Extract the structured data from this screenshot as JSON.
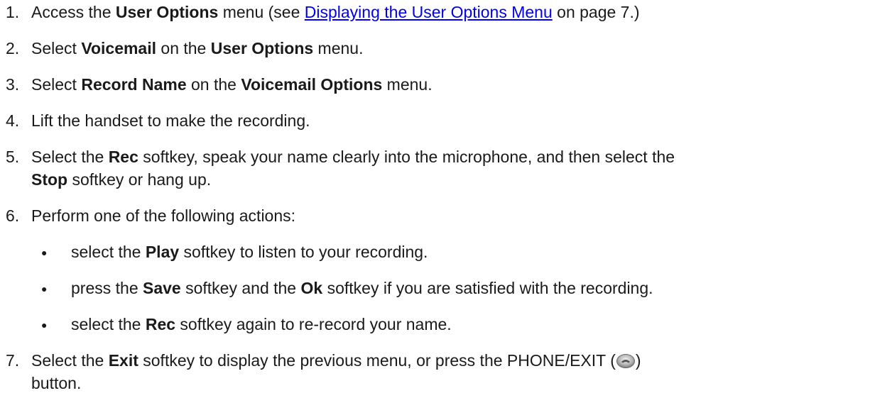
{
  "steps": [
    {
      "num": "1.",
      "t1": "Access the ",
      "b1": "User Options",
      "t2": " menu (see ",
      "link": "Displaying the User Options Menu",
      "t3": " on page 7.)"
    },
    {
      "num": "2.",
      "t1": "Select ",
      "b1": "Voicemail",
      "t2": " on the ",
      "b2": "User Options",
      "t3": " menu."
    },
    {
      "num": "3.",
      "t1": "Select ",
      "b1": "Record Name",
      "t2": " on the ",
      "b2": "Voicemail Options",
      "t3": " menu."
    },
    {
      "num": "4.",
      "t1": "Lift the handset to make the recording."
    },
    {
      "num": "5.",
      "t1": "Select the ",
      "b1": "Rec",
      "t2": " softkey, speak your name clearly into the microphone, and then select the",
      "b2": "Stop",
      "t3": " softkey or hang up."
    },
    {
      "num": "6.",
      "t1": "Perform one of the following actions:",
      "subs": [
        {
          "bullet": "●",
          "t1": "select the ",
          "b1": "Play",
          "t2": " softkey to listen to your recording."
        },
        {
          "bullet": "●",
          "t1": "press the ",
          "b1": "Save",
          "t2": " softkey and the ",
          "b2": "Ok",
          "t3": " softkey if you are satisfied with the recording."
        },
        {
          "bullet": "●",
          "t1": "select the ",
          "b1": "Rec",
          "t2": " softkey again to re-record your name."
        }
      ]
    },
    {
      "num": "7.",
      "t1": "Select the ",
      "b1": "Exit",
      "t2": " softkey to display the previous menu, or press the PHONE/EXIT (",
      "icon": "phone-exit-button-icon",
      "t3": ")",
      "t4": "button."
    }
  ]
}
